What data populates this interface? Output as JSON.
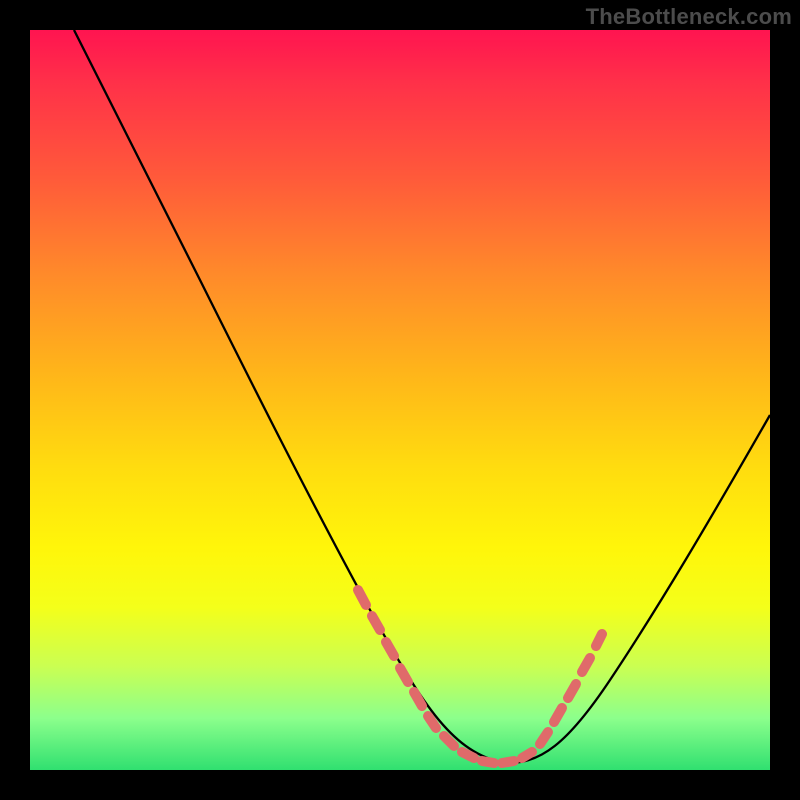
{
  "watermark": "TheBottleneck.com",
  "chart_data": {
    "type": "line",
    "title": "",
    "xlabel": "",
    "ylabel": "",
    "xlim": [
      0,
      100
    ],
    "ylim": [
      0,
      100
    ],
    "grid": false,
    "legend": false,
    "background_gradient": {
      "top": "#ff1450",
      "bottom": "#30e070",
      "stops": [
        "#ff1450",
        "#ff5a3a",
        "#ffb41a",
        "#fff60a",
        "#caff52",
        "#30e070"
      ]
    },
    "series": [
      {
        "name": "bottleneck-curve",
        "color": "#000000",
        "x": [
          6,
          10,
          15,
          20,
          25,
          30,
          35,
          40,
          45,
          50,
          53,
          56,
          59,
          62,
          65,
          68,
          71,
          75,
          80,
          85,
          90,
          95,
          100
        ],
        "y": [
          100,
          92,
          82,
          72,
          63,
          53,
          44,
          35,
          26,
          18,
          12,
          7,
          3,
          1,
          0.5,
          1,
          3,
          7,
          14,
          22,
          30,
          39,
          48
        ]
      },
      {
        "name": "highlight-dots",
        "color": "#e86a6a",
        "type": "scatter",
        "x": [
          48,
          50,
          52,
          54,
          56,
          58,
          60,
          62,
          64,
          66,
          68,
          70,
          72,
          74,
          76,
          78
        ],
        "y": [
          21,
          18,
          15,
          11,
          8,
          5,
          3,
          1.5,
          0.8,
          0.8,
          1.5,
          3,
          5,
          8,
          11,
          14
        ]
      }
    ],
    "annotations": []
  }
}
